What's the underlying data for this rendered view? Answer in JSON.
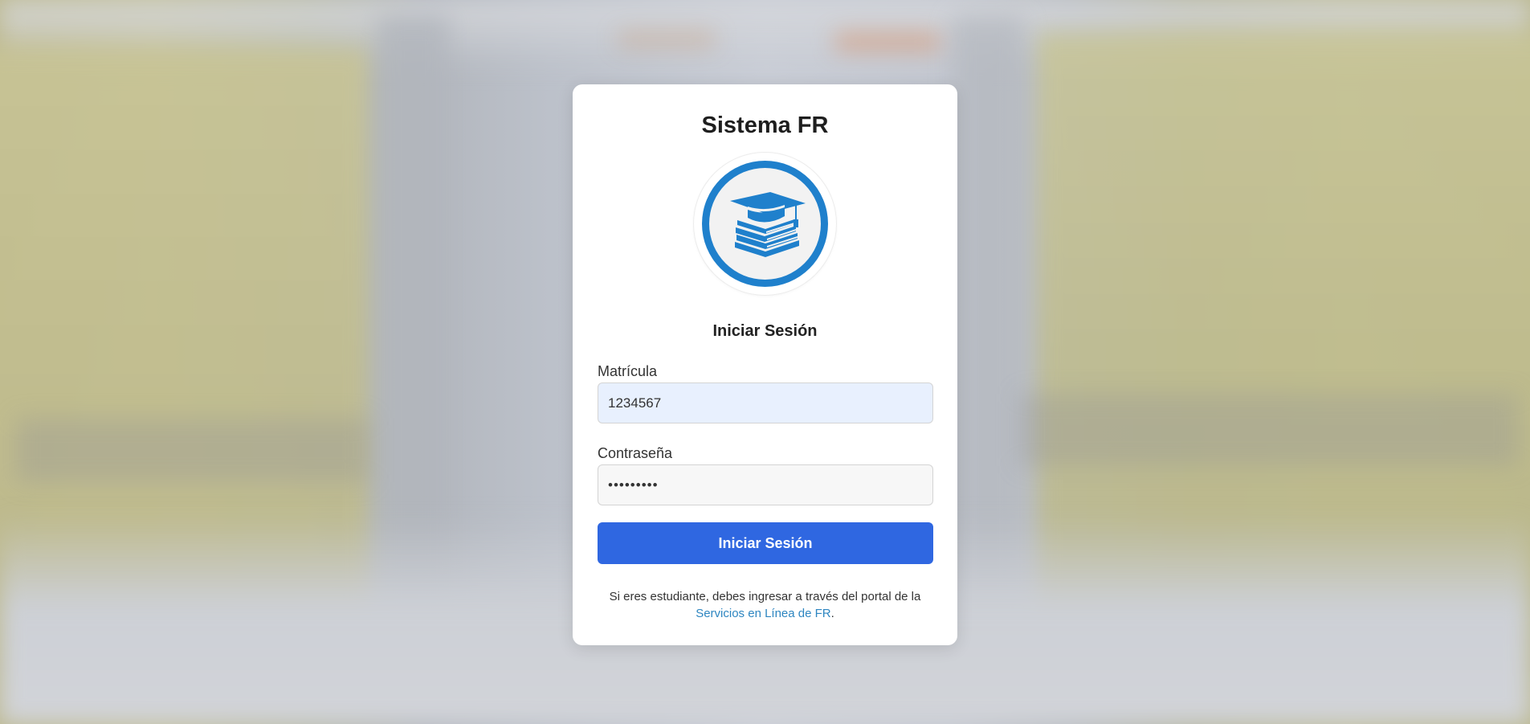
{
  "background": {
    "description_icon": "blurred-hallway-lockers"
  },
  "login": {
    "title": "Sistema FR",
    "logo_icon": "graduation-cap-books-icon",
    "heading": "Iniciar Sesión",
    "matricula_label": "Matrícula",
    "matricula_value": "1234567",
    "password_label": "Contraseña",
    "password_value": "•••••••••",
    "submit_label": "Iniciar Sesión",
    "note_text": "Si eres estudiante, debes ingresar a través del portal de la",
    "note_link": "Servicios en Línea de FR",
    "note_period": "."
  },
  "colors": {
    "primary_button": "#2f67e1",
    "logo_blue": "#1f80cc",
    "link": "#2e86c1",
    "autofill_bg": "#e8f0fe"
  }
}
